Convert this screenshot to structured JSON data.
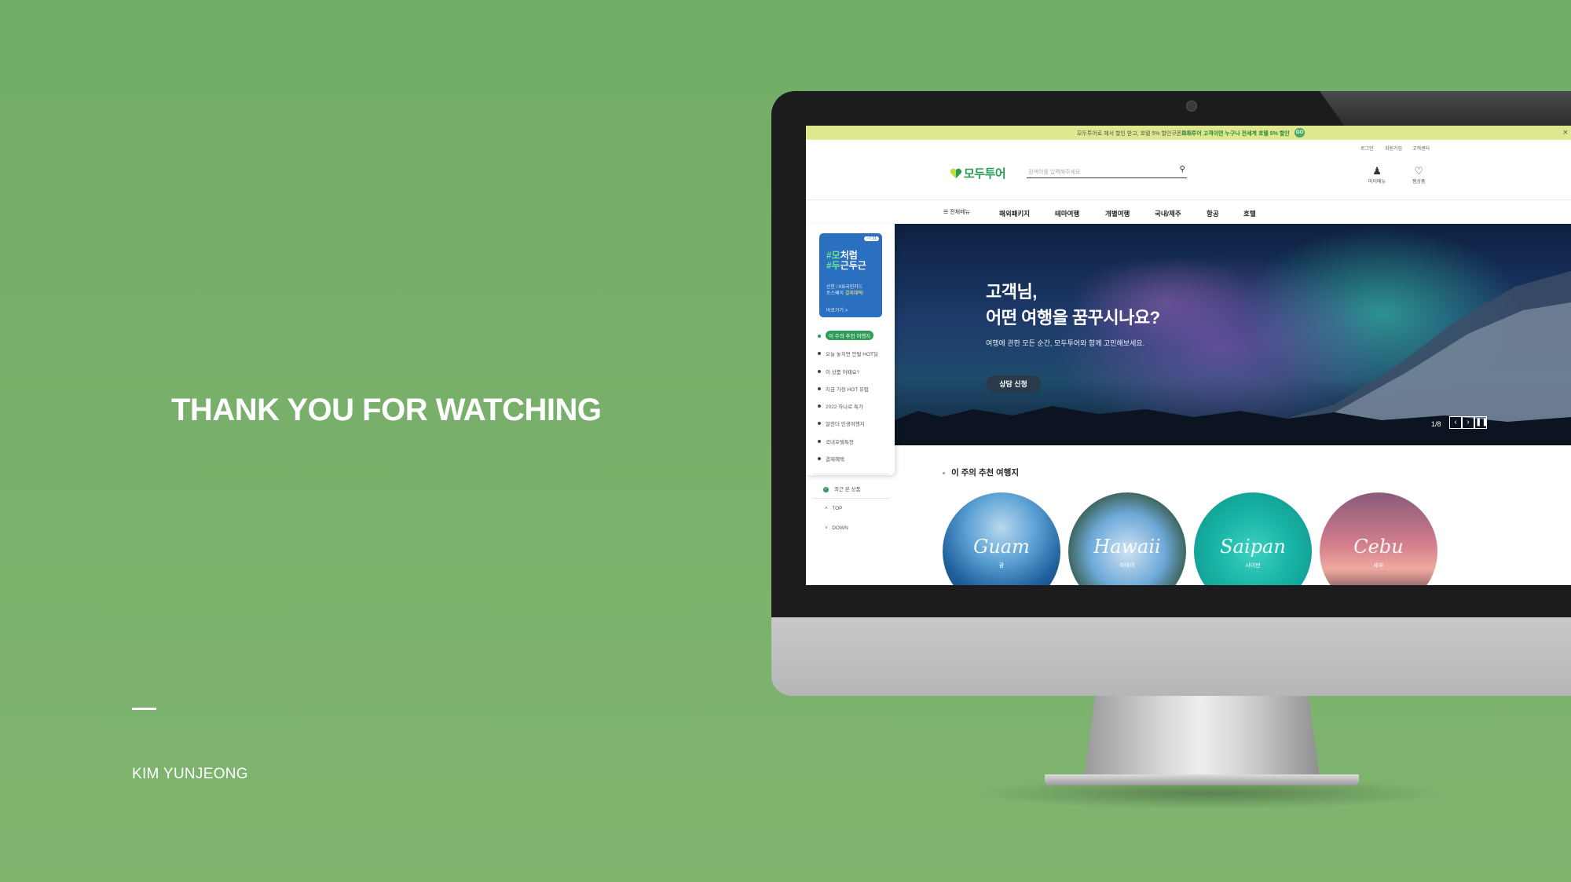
{
  "slide": {
    "headline": "THANK YOU FOR WATCHING",
    "author": "KIM YUNJEONG"
  },
  "site": {
    "promo": {
      "text": "모두투어로 혜서 할인 받고, 호텔 5% 할인쿠폰까지!",
      "highlight": "모두투어 고객이면 누구나 전세계 호텔 5% 할인",
      "go": "GO",
      "close": "×"
    },
    "util_links": [
      "로그인",
      "회원가입",
      "고객센터"
    ],
    "logo": "모두투어",
    "search": {
      "placeholder": "검색어를 입력해주세요"
    },
    "header_icons": [
      {
        "icon": "user-icon",
        "label": "마이메뉴"
      },
      {
        "icon": "heart-icon",
        "label": "찜상품"
      }
    ],
    "nav": {
      "all_menu": "전체메뉴",
      "items": [
        "해외패키지",
        "테마여행",
        "개별여행",
        "국내/제주",
        "항공",
        "호텔"
      ]
    },
    "hero": {
      "line1": "고객님,",
      "line2": "어떤 여행을 꿈꾸시나요?",
      "sub": "여행에 관한 모든 순간, 모두투어와 함께 고민해보세요.",
      "cta": "상담 신청",
      "pager": "1/8"
    },
    "sidebar": {
      "card": {
        "days": "~7.31",
        "title_a_mark": "#모",
        "title_a_rest": "처럼",
        "title_b_mark": "#두",
        "title_b_rest": "근두근",
        "desc_line1": "신한 / KB국민카드",
        "desc_line2_a": "토스페이 ",
        "desc_line2_b": "결제혜택!",
        "more": "바로가기 >"
      },
      "items": [
        "이 주의 추천 여행지",
        "오늘 놓치면 안될 HOT딜",
        "이 상품 어때요?",
        "지금 가장 HOT 유럽",
        "2022 하나로 특가",
        "알찬더 인생여행지",
        "국내호텔특장",
        "결제혜택"
      ],
      "recent": "최근 본 상품",
      "top": "TOP",
      "down": "DOWN"
    },
    "recommend": {
      "title": "이 주의 추천 여행지",
      "places": [
        {
          "script": "Guam",
          "kr": "괌"
        },
        {
          "script": "Hawaii",
          "kr": "하와이"
        },
        {
          "script": "Saipan",
          "kr": "사이판"
        },
        {
          "script": "Cebu",
          "kr": "세부"
        }
      ]
    }
  },
  "colors": {
    "background": "#75ae68",
    "brand_green": "#2a9c54",
    "promo_bar": "#dfe88f",
    "sidebar_card": "#2a6fc0"
  }
}
